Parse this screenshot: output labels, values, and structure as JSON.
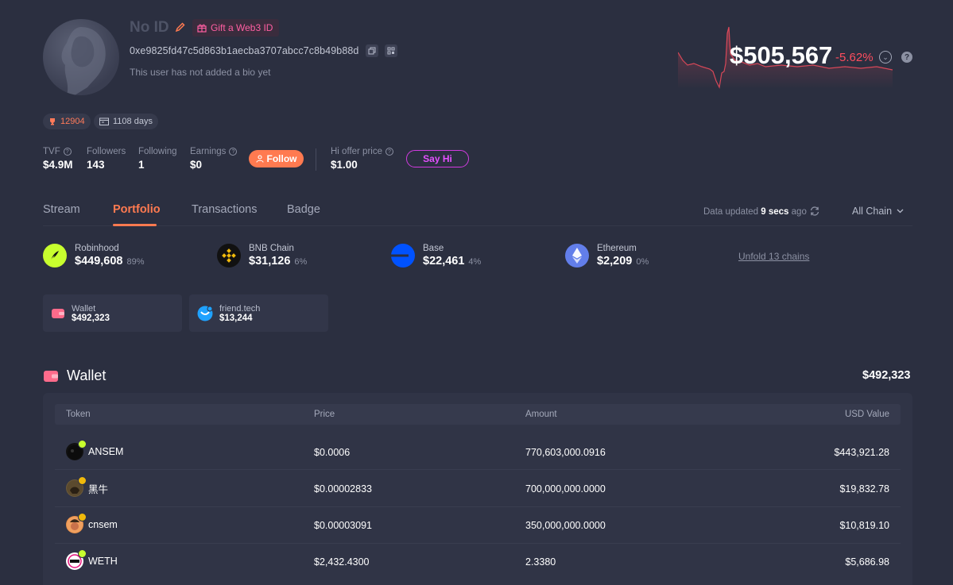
{
  "profile": {
    "name": "No ID",
    "gift_label": "Gift a Web3 ID",
    "address": "0xe9825fd47c5d863b1aecba3707abcc7c8b49b88d",
    "bio": "This user has not added a bio yet",
    "score": "12904",
    "days": "1108 days"
  },
  "net_worth": {
    "total": "$505,567",
    "change": "-5.62%"
  },
  "stats": {
    "tvf_label": "TVF",
    "tvf": "$4.9M",
    "followers_label": "Followers",
    "followers": "143",
    "following_label": "Following",
    "following": "1",
    "earnings_label": "Earnings",
    "earnings": "$0",
    "follow_label": "Follow",
    "hi_offer_label": "Hi offer price",
    "hi_offer": "$1.00",
    "say_hi_label": "Say Hi"
  },
  "tabs": [
    {
      "label": "Stream"
    },
    {
      "label": "Portfolio"
    },
    {
      "label": "Transactions"
    },
    {
      "label": "Badge"
    }
  ],
  "update_info": {
    "prefix": "Data updated",
    "time": "9 secs",
    "suffix": "ago",
    "chain_filter": "All Chain"
  },
  "chains": [
    {
      "name": "Robinhood",
      "value": "$449,608",
      "pct": "89%",
      "color": "#c8ff2e"
    },
    {
      "name": "BNB Chain",
      "value": "$31,126",
      "pct": "6%",
      "color": "#f0b90b"
    },
    {
      "name": "Base",
      "value": "$22,461",
      "pct": "4%",
      "color": "#0052ff"
    },
    {
      "name": "Ethereum",
      "value": "$2,209",
      "pct": "0%",
      "color": "#627eea"
    }
  ],
  "unfold_label": "Unfold 13 chains",
  "protocols": [
    {
      "name": "Wallet",
      "value": "$492,323"
    },
    {
      "name": "friend.tech",
      "value": "$13,244"
    }
  ],
  "wallet": {
    "title": "Wallet",
    "total": "$492,323",
    "headers": {
      "token": "Token",
      "price": "Price",
      "amount": "Amount",
      "usd": "USD Value"
    },
    "rows": [
      {
        "token": "ANSEM",
        "price": "$0.0006",
        "amount": "770,603,000.0916",
        "usd": "$443,921.28"
      },
      {
        "token": "黑牛",
        "price": "$0.00002833",
        "amount": "700,000,000.0000",
        "usd": "$19,832.78"
      },
      {
        "token": "cnsem",
        "price": "$0.00003091",
        "amount": "350,000,000.0000",
        "usd": "$10,819.10"
      },
      {
        "token": "WETH",
        "price": "$2,432.4300",
        "amount": "2.3380",
        "usd": "$5,686.98"
      }
    ]
  },
  "colors": {
    "accent": "#ff7a50",
    "negative": "#ff4d5e",
    "say_hi": "#e450ff"
  }
}
